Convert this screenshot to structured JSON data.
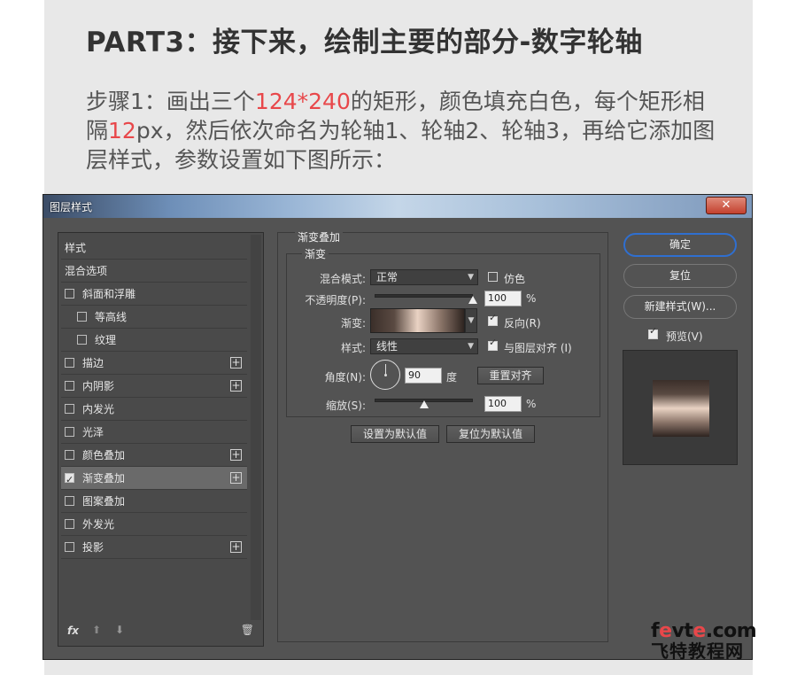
{
  "article": {
    "heading": "PART3：接下来，绘制主要的部分-数字轮轴",
    "intro_parts": [
      "步骤1：画出三个",
      "124*240",
      "的矩形，颜色填充白色，每个矩形相隔",
      "12",
      "px，然后依次命名为轮轴1、轮轴2、轮轴3，再给它添加图层样式，参数设置如下图所示："
    ]
  },
  "dialog": {
    "title": "图层样式",
    "close_label": "✕",
    "left_panel": {
      "items": [
        {
          "label": "样式",
          "checkbox": false,
          "checked": false,
          "indent": false,
          "plus": false,
          "selected": false
        },
        {
          "label": "混合选项",
          "checkbox": false,
          "checked": false,
          "indent": false,
          "plus": false,
          "selected": false
        },
        {
          "label": "斜面和浮雕",
          "checkbox": true,
          "checked": false,
          "indent": false,
          "plus": false,
          "selected": false
        },
        {
          "label": "等高线",
          "checkbox": true,
          "checked": false,
          "indent": true,
          "plus": false,
          "selected": false
        },
        {
          "label": "纹理",
          "checkbox": true,
          "checked": false,
          "indent": true,
          "plus": false,
          "selected": false
        },
        {
          "label": "描边",
          "checkbox": true,
          "checked": false,
          "indent": false,
          "plus": true,
          "selected": false
        },
        {
          "label": "内阴影",
          "checkbox": true,
          "checked": false,
          "indent": false,
          "plus": true,
          "selected": false
        },
        {
          "label": "内发光",
          "checkbox": true,
          "checked": false,
          "indent": false,
          "plus": false,
          "selected": false
        },
        {
          "label": "光泽",
          "checkbox": true,
          "checked": false,
          "indent": false,
          "plus": false,
          "selected": false
        },
        {
          "label": "颜色叠加",
          "checkbox": true,
          "checked": false,
          "indent": false,
          "plus": true,
          "selected": false
        },
        {
          "label": "渐变叠加",
          "checkbox": true,
          "checked": true,
          "indent": false,
          "plus": true,
          "selected": true
        },
        {
          "label": "图案叠加",
          "checkbox": true,
          "checked": false,
          "indent": false,
          "plus": false,
          "selected": false
        },
        {
          "label": "外发光",
          "checkbox": true,
          "checked": false,
          "indent": false,
          "plus": false,
          "selected": false
        },
        {
          "label": "投影",
          "checkbox": true,
          "checked": false,
          "indent": false,
          "plus": true,
          "selected": false
        }
      ],
      "footer_icons": [
        "fx-icon",
        "arrow-up-icon",
        "arrow-down-icon",
        "trash-icon"
      ],
      "fx_label": "fx",
      "up_glyph": "⬆",
      "down_glyph": "⬇",
      "trash_glyph": "🗑"
    },
    "gradient_overlay": {
      "group_title": "渐变叠加",
      "sub_title": "渐变",
      "blend_mode_label": "混合模式:",
      "blend_mode_value": "正常",
      "dither_label": "仿色",
      "dither_checked": false,
      "opacity_label": "不透明度(P):",
      "opacity_value": "100",
      "opacity_unit": "%",
      "opacity_fraction": 1.0,
      "gradient_label": "渐变:",
      "reverse_label": "反向(R)",
      "reverse_checked": true,
      "style_label": "样式:",
      "style_value": "线性",
      "align_label": "与图层对齐 (I)",
      "align_checked": true,
      "angle_label": "角度(N):",
      "angle_value": "90",
      "angle_unit": "度",
      "reset_align_label": "重置对齐",
      "scale_label": "缩放(S):",
      "scale_value": "100",
      "scale_unit": "%",
      "scale_fraction": 0.5,
      "set_default_label": "设置为默认值",
      "reset_default_label": "复位为默认值",
      "gradient_colors": [
        "#3b2f2a",
        "#5a4a42",
        "#e9d2c3",
        "#8a7468",
        "#2e2420"
      ]
    },
    "right": {
      "ok_label": "确定",
      "reset_label": "复位",
      "new_style_label": "新建样式(W)...",
      "preview_label": "预览(V)",
      "preview_checked": true
    }
  },
  "watermark": {
    "site_prefix": "f",
    "site_e1": "e",
    "site_mid": "vt",
    "site_e2": "e",
    "site_suffix": ".com",
    "site_name": "飞特教程网"
  }
}
